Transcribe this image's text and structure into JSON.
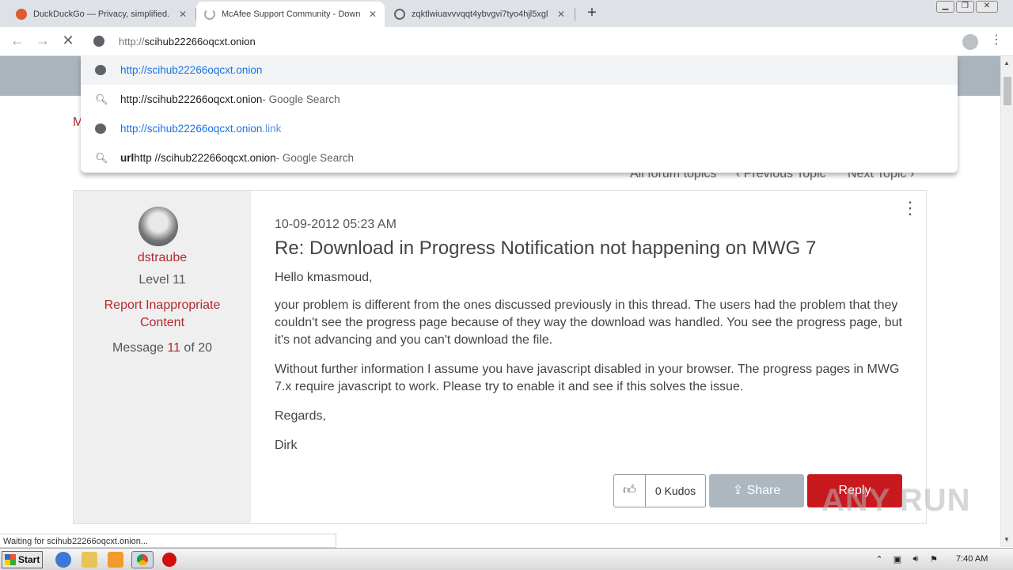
{
  "browser": {
    "tabs": [
      {
        "title": "DuckDuckGo — Privacy, simplified.",
        "favicon": "duckduckgo-icon"
      },
      {
        "title": "McAfee Support Community - Downl",
        "favicon": "loading-spinner-icon",
        "active": true
      },
      {
        "title": "zqktlwiuavvvqqt4ybvgvi7tyo4hjl5xgl",
        "favicon": "globe-icon"
      }
    ],
    "address": {
      "scheme": "http://",
      "host": "scihub22266oqcxt.onion"
    },
    "suggestions": [
      {
        "icon": "globe-icon",
        "main": "http://scihub22266oqcxt.onion",
        "suffix": ""
      },
      {
        "icon": "search-icon",
        "main": "http://scihub22266oqcxt.onion",
        "suffix": " - Google Search"
      },
      {
        "icon": "globe-icon",
        "main": "http://scihub22266oqcxt.onion",
        "suffix": ".link"
      },
      {
        "icon": "search-icon",
        "prefix": "url",
        "main": " http //scihub22266oqcxt.onion",
        "suffix": " - Google Search"
      }
    ],
    "status_text": "Waiting for scihub22266oqcxt.onion..."
  },
  "page": {
    "fragment_letter": "M",
    "forum_nav": {
      "all": "All forum topics",
      "prev": "Previous Topic",
      "next": "Next Topic"
    },
    "author": {
      "name": "dstraube",
      "level": "Level 11",
      "report": "Report Inappropriate Content",
      "message_prefix": "Message ",
      "message_num": "11",
      "message_suffix": " of 20"
    },
    "post": {
      "date": "10-09-2012 05:23 AM",
      "title": "Re: Download in Progress Notification not happening on MWG 7",
      "paragraphs": [
        "Hello kmasmoud,",
        "your problem is different from the ones discussed previously in this thread. The users had the problem that they couldn't see the progress page because of they way the download was handled. You see the progress page, but it's not advancing and you can't download the file.",
        "Without further information I assume you have javascript disabled in your browser. The progress pages in MWG 7.x require javascript to work. Please try to enable it and see if this solves the issue.",
        "Regards,",
        "Dirk"
      ],
      "kudos": "0 Kudos",
      "share": "Share",
      "reply": "Reply"
    }
  },
  "taskbar": {
    "start": "Start",
    "clock": "7:40 AM"
  },
  "watermark": "ANY RUN",
  "colors": {
    "brand_red": "#c8191f",
    "link_blue": "#1a73e8"
  }
}
